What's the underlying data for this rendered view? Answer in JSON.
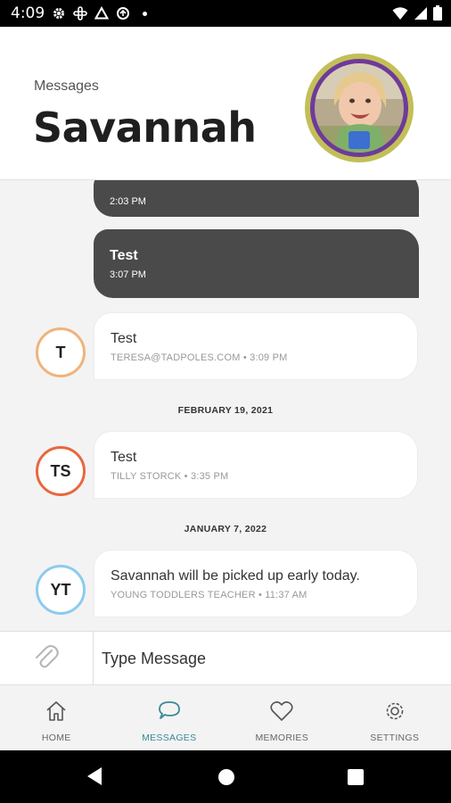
{
  "status_bar": {
    "time": "4:09"
  },
  "header": {
    "label": "Messages",
    "title": "Savannah"
  },
  "messages": [
    {
      "type": "outgoing",
      "time": "2:03 PM"
    },
    {
      "type": "outgoing",
      "text": "Test",
      "time": "3:07 PM"
    },
    {
      "type": "incoming",
      "initials": "T",
      "text": "Test",
      "meta": "TERESA@TADPOLES.COM • 3:09 PM",
      "color": "#f0b37a"
    },
    {
      "type": "date",
      "text": "FEBRUARY 19, 2021"
    },
    {
      "type": "incoming",
      "initials": "TS",
      "text": "Test",
      "meta": "TILLY STORCK • 3:35 PM",
      "color": "#e8683e"
    },
    {
      "type": "date",
      "text": "JANUARY 7, 2022"
    },
    {
      "type": "incoming",
      "initials": "YT",
      "text": "Savannah will be picked up early today.",
      "meta": "YOUNG TODDLERS TEACHER • 11:37 AM",
      "color": "#8ccbef"
    }
  ],
  "composer": {
    "placeholder": "Type Message"
  },
  "nav": [
    {
      "label": "HOME",
      "icon": "home-icon"
    },
    {
      "label": "MESSAGES",
      "icon": "chat-icon",
      "active": true
    },
    {
      "label": "MEMORIES",
      "icon": "heart-icon"
    },
    {
      "label": "SETTINGS",
      "icon": "gear-icon"
    }
  ],
  "colors": {
    "accent": "#3a8a95",
    "outgoing_bubble": "#4a4a4a",
    "avatar_ring": "#c2bf58",
    "avatar_border": "#6e3a9a"
  }
}
